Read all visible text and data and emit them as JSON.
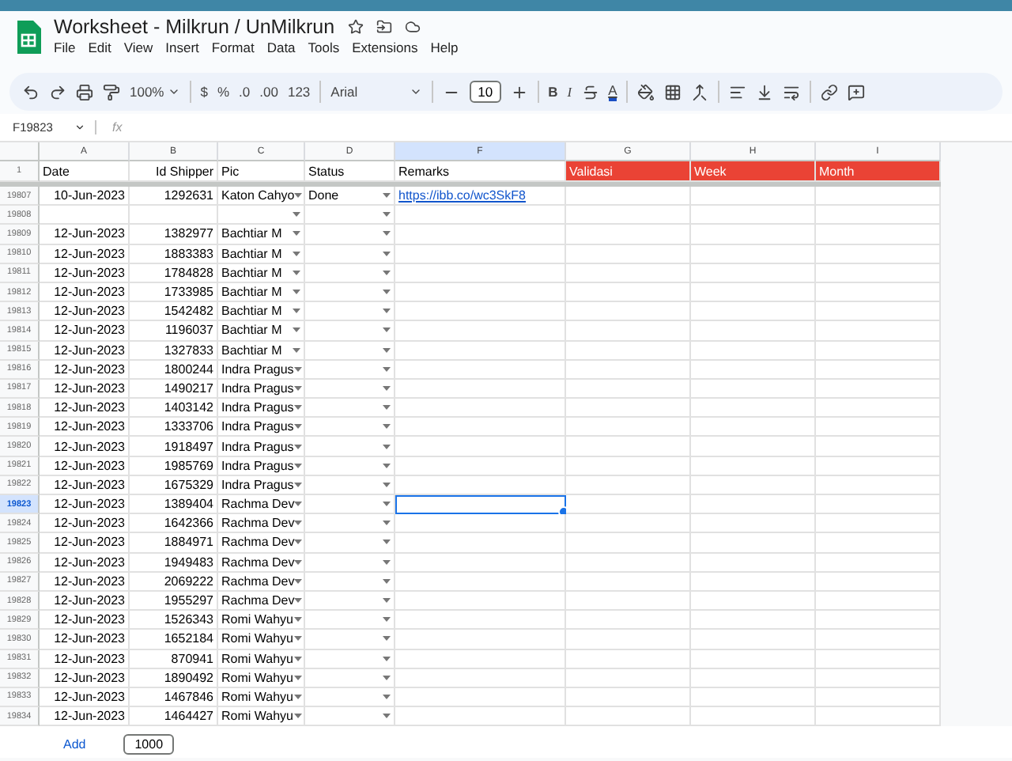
{
  "window": {
    "title": "Worksheet - Milkrun / UnMilkrun"
  },
  "menu": [
    "File",
    "Edit",
    "View",
    "Insert",
    "Format",
    "Data",
    "Tools",
    "Extensions",
    "Help"
  ],
  "toolbar": {
    "zoom": "100%",
    "currency": "$",
    "percent": "%",
    "decimal_less": ".0",
    "decimal_more": ".00",
    "number_format": "123",
    "font": "Arial",
    "font_size": "10",
    "bold": "B",
    "italic": "I",
    "text_color": "A"
  },
  "formula_bar": {
    "name_box": "F19823",
    "fx": "fx"
  },
  "columns": [
    {
      "letter": "A",
      "selected": false
    },
    {
      "letter": "B",
      "selected": false
    },
    {
      "letter": "C",
      "selected": false
    },
    {
      "letter": "D",
      "selected": false
    },
    {
      "letter": "F",
      "selected": true
    },
    {
      "letter": "G",
      "selected": false
    },
    {
      "letter": "H",
      "selected": false
    },
    {
      "letter": "I",
      "selected": false
    }
  ],
  "header_row": {
    "num": "1",
    "cells": [
      {
        "text": "Date",
        "color": "#ffffff"
      },
      {
        "text": "Id Shipper",
        "color": "#ffffff"
      },
      {
        "text": "Pic",
        "color": "#ffffff"
      },
      {
        "text": "Status",
        "color": "#ffffff"
      },
      {
        "text": "Remarks",
        "color": "#ffffff"
      },
      {
        "text": "Validasi",
        "color": "#ea4335"
      },
      {
        "text": "Week",
        "color": "#ea4335"
      },
      {
        "text": "Month",
        "color": "#ea4335"
      }
    ]
  },
  "rows": [
    {
      "num": "19807",
      "date": "10-Jun-2023",
      "id": "1292631",
      "pic": "Katon Cahyo",
      "status": "Done",
      "remarks": "https://ibb.co/wc3SkF8",
      "selected": false
    },
    {
      "num": "19808",
      "selected": false
    },
    {
      "num": "19809",
      "date": "12-Jun-2023",
      "id": "1382977",
      "pic": "Bachtiar M",
      "selected": false
    },
    {
      "num": "19810",
      "date": "12-Jun-2023",
      "id": "1883383",
      "pic": "Bachtiar M",
      "selected": false
    },
    {
      "num": "19811",
      "date": "12-Jun-2023",
      "id": "1784828",
      "pic": "Bachtiar M",
      "selected": false
    },
    {
      "num": "19812",
      "date": "12-Jun-2023",
      "id": "1733985",
      "pic": "Bachtiar M",
      "selected": false
    },
    {
      "num": "19813",
      "date": "12-Jun-2023",
      "id": "1542482",
      "pic": "Bachtiar M",
      "selected": false
    },
    {
      "num": "19814",
      "date": "12-Jun-2023",
      "id": "1196037",
      "pic": "Bachtiar M",
      "selected": false
    },
    {
      "num": "19815",
      "date": "12-Jun-2023",
      "id": "1327833",
      "pic": "Bachtiar M",
      "selected": false
    },
    {
      "num": "19816",
      "date": "12-Jun-2023",
      "id": "1800244",
      "pic": "Indra Pragus",
      "selected": false
    },
    {
      "num": "19817",
      "date": "12-Jun-2023",
      "id": "1490217",
      "pic": "Indra Pragus",
      "selected": false
    },
    {
      "num": "19818",
      "date": "12-Jun-2023",
      "id": "1403142",
      "pic": "Indra Pragus",
      "selected": false
    },
    {
      "num": "19819",
      "date": "12-Jun-2023",
      "id": "1333706",
      "pic": "Indra Pragus",
      "selected": false
    },
    {
      "num": "19820",
      "date": "12-Jun-2023",
      "id": "1918497",
      "pic": "Indra Pragus",
      "selected": false
    },
    {
      "num": "19821",
      "date": "12-Jun-2023",
      "id": "1985769",
      "pic": "Indra Pragus",
      "selected": false
    },
    {
      "num": "19822",
      "date": "12-Jun-2023",
      "id": "1675329",
      "pic": "Indra Pragus",
      "selected": false
    },
    {
      "num": "19823",
      "date": "12-Jun-2023",
      "id": "1389404",
      "pic": "Rachma Dev",
      "selected": true
    },
    {
      "num": "19824",
      "date": "12-Jun-2023",
      "id": "1642366",
      "pic": "Rachma Dev",
      "selected": false
    },
    {
      "num": "19825",
      "date": "12-Jun-2023",
      "id": "1884971",
      "pic": "Rachma Dev",
      "selected": false
    },
    {
      "num": "19826",
      "date": "12-Jun-2023",
      "id": "1949483",
      "pic": "Rachma Dev",
      "selected": false
    },
    {
      "num": "19827",
      "date": "12-Jun-2023",
      "id": "2069222",
      "pic": "Rachma Dev",
      "selected": false
    },
    {
      "num": "19828",
      "date": "12-Jun-2023",
      "id": "1955297",
      "pic": "Rachma Dev",
      "selected": false
    },
    {
      "num": "19829",
      "date": "12-Jun-2023",
      "id": "1526343",
      "pic": "Romi Wahyu",
      "selected": false
    },
    {
      "num": "19830",
      "date": "12-Jun-2023",
      "id": "1652184",
      "pic": "Romi Wahyu",
      "selected": false
    },
    {
      "num": "19831",
      "date": "12-Jun-2023",
      "id": "870941",
      "pic": "Romi Wahyu",
      "selected": false
    },
    {
      "num": "19832",
      "date": "12-Jun-2023",
      "id": "1890492",
      "pic": "Romi Wahyu",
      "selected": false
    },
    {
      "num": "19833",
      "date": "12-Jun-2023",
      "id": "1467846",
      "pic": "Romi Wahyu",
      "selected": false
    },
    {
      "num": "19834",
      "date": "12-Jun-2023",
      "id": "1464427",
      "pic": "Romi Wahyu",
      "selected": false
    }
  ],
  "footer": {
    "add": "Add",
    "count": "1000"
  }
}
